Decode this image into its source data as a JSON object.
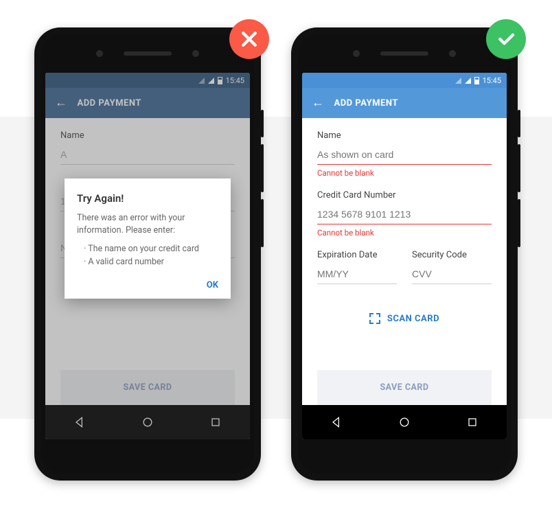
{
  "status": {
    "time": "15:45"
  },
  "header": {
    "title": "ADD PAYMENT"
  },
  "fields": {
    "name_label": "Name",
    "name_placeholder": "As shown on card",
    "name_error": "Cannot be blank",
    "cc_label": "Credit Card Number",
    "cc_placeholder": "1234 5678 9101 1213",
    "cc_error": "Cannot be blank",
    "exp_label": "Expiration Date",
    "exp_placeholder": "MM/YY",
    "cvv_label": "Security Code",
    "cvv_placeholder": "CVV"
  },
  "scan_label": "SCAN CARD",
  "save_label": "SAVE CARD",
  "dialog": {
    "title": "Try Again!",
    "message": "There was an error with your information. Please enter:",
    "items": [
      "The name on your credit card",
      "A valid card number"
    ],
    "ok": "OK"
  },
  "left_hidden": {
    "name_value": "A",
    "cc_value": "1",
    "exp_value": "N"
  }
}
